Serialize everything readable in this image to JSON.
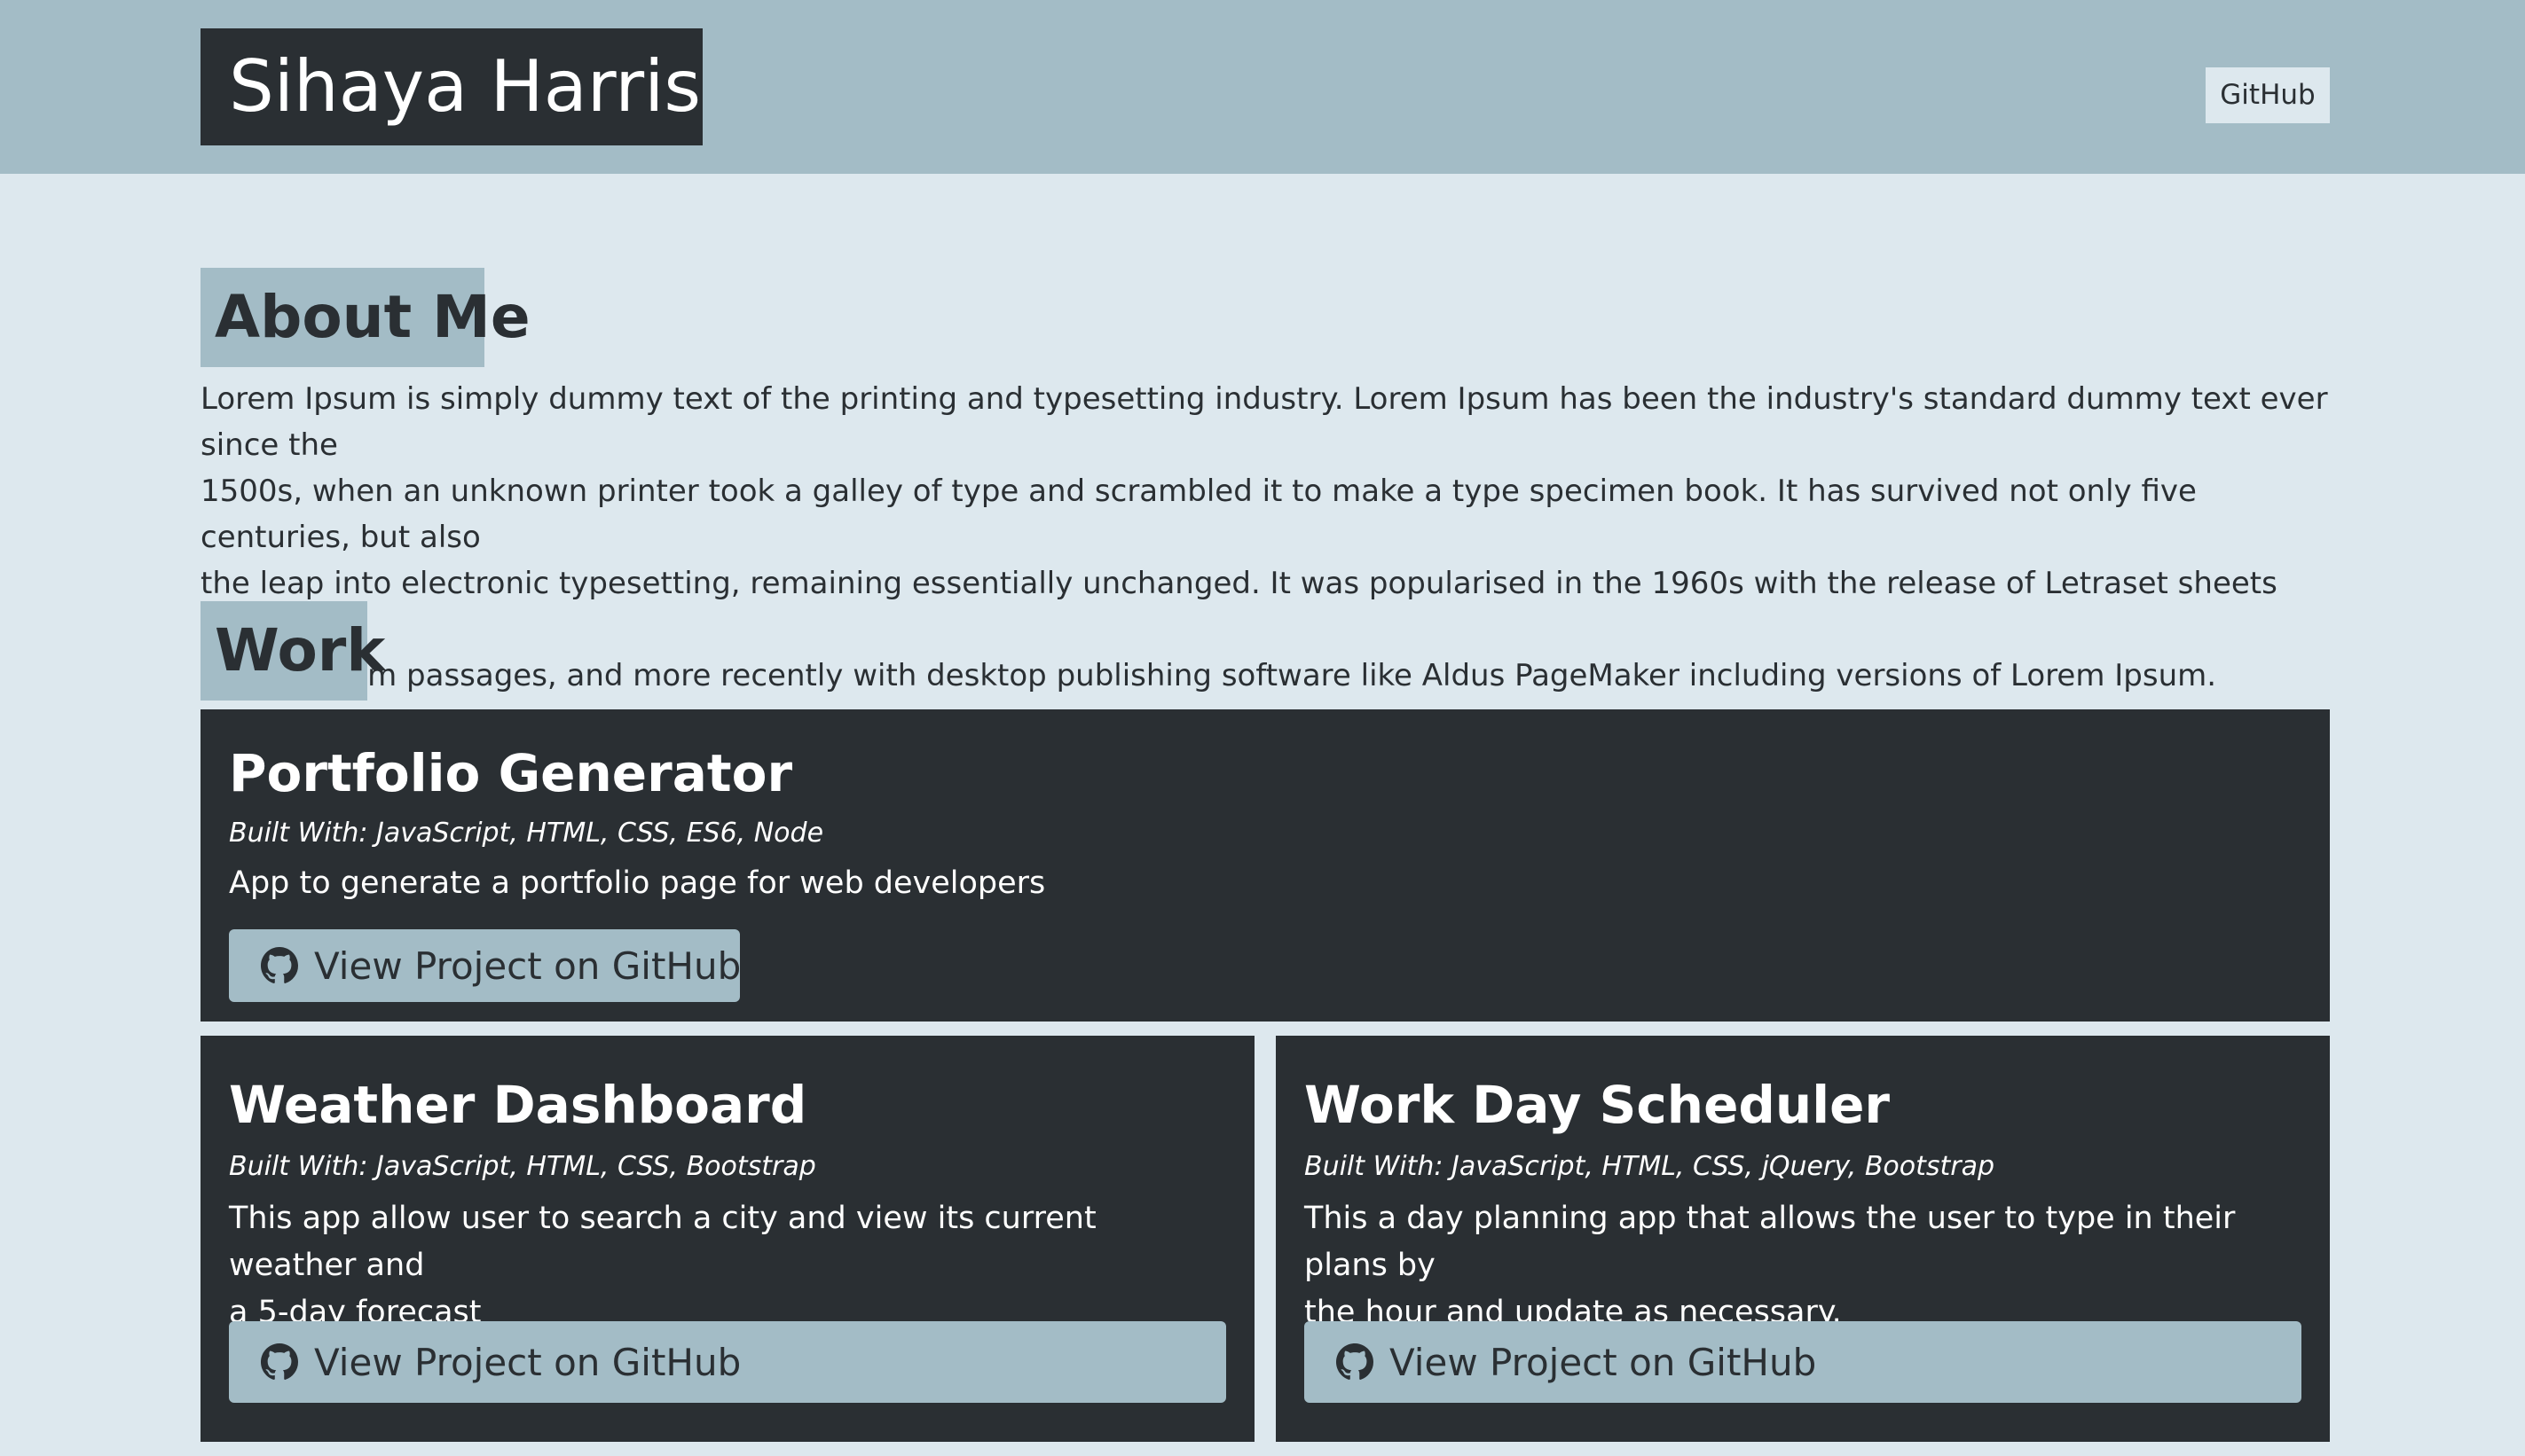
{
  "header": {
    "name": "Sihaya Harris",
    "nav_github": "GitHub"
  },
  "about": {
    "heading": "About Me",
    "text": "Lorem Ipsum is simply dummy text of the printing and typesetting industry. Lorem Ipsum has been the industry's standard dummy text ever since the\n1500s, when an unknown printer took a galley of type and scrambled it to make a type specimen book. It has survived not only five centuries, but also\nthe leap into electronic typesetting, remaining essentially unchanged. It was popularised in the 1960s with the release of Letraset sheets containing\nLorem Ipsum passages, and more recently with desktop publishing software like Aldus PageMaker including versions of Lorem Ipsum."
  },
  "work": {
    "heading": "Work",
    "projects": [
      {
        "title": "Portfolio Generator",
        "built_with": "Built With: JavaScript, HTML, CSS, ES6, Node",
        "description": "App to generate a portfolio page for web developers",
        "button_label": "View Project on GitHub",
        "button_icon": "github-icon"
      },
      {
        "title": "Weather Dashboard",
        "built_with": "Built With: JavaScript, HTML, CSS, Bootstrap",
        "description": "This app allow user to search a city and view its current weather and\na 5-day forecast",
        "button_label": "View Project on GitHub",
        "button_icon": "github-icon"
      },
      {
        "title": "Work Day Scheduler",
        "built_with": "Built With: JavaScript, HTML, CSS, jQuery, Bootstrap",
        "description": "This a day planning app that allows the user to type in their plans by\nthe hour and update as necessary.",
        "button_label": "View Project on GitHub",
        "button_icon": "github-icon"
      }
    ]
  },
  "colors": {
    "header_bg": "#a3bcc6",
    "page_bg": "#dde8ee",
    "dark": "#2a2f33",
    "accent": "#a3bcc6"
  }
}
